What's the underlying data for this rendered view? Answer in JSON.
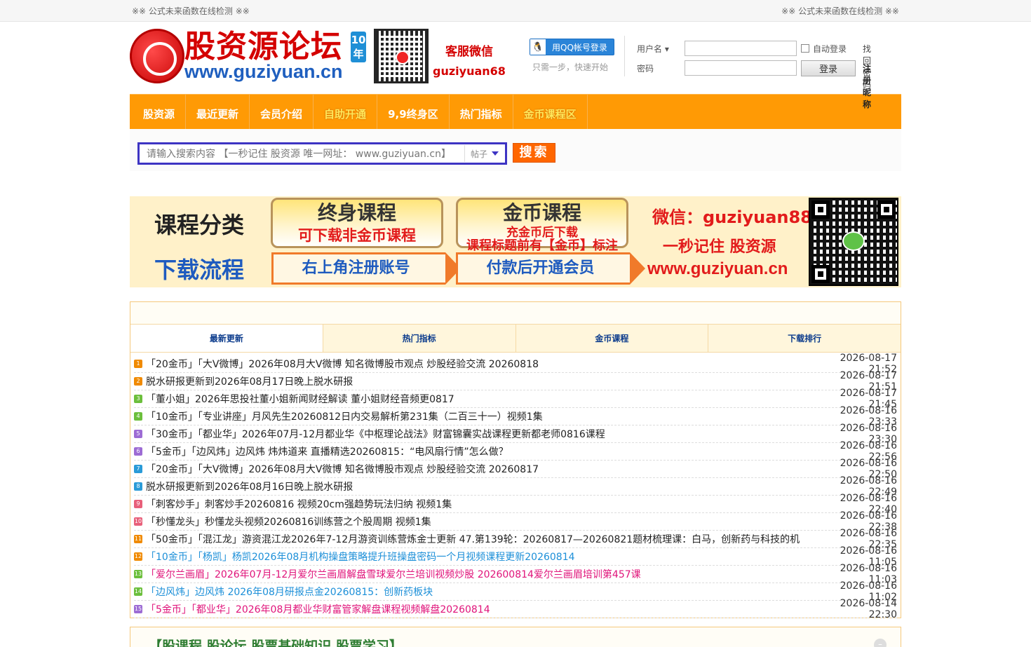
{
  "topbar": {
    "left": "※※ 公式未来函数在线检测 ※※",
    "right": "※※ 公式未来函数在线检测 ※※"
  },
  "logo": {
    "title": "股资源论坛",
    "url": "www.guziyuan.cn",
    "years": "10年"
  },
  "service": {
    "title": "客服微信",
    "wechat": "guziyuan68"
  },
  "qq": {
    "button": "用QQ帐号登录",
    "tip": "只需一步，快速开始"
  },
  "login": {
    "username_label": "用户名",
    "password_label": "密码",
    "auto_login": "自动登录",
    "login_button": "登录",
    "find_password": "找回密码",
    "register": "注册昵称"
  },
  "nav": [
    "股资源",
    "最近更新",
    "会员介绍",
    "自助开通",
    "9,9终身区",
    "热门指标",
    "金币课程区"
  ],
  "search": {
    "placeholder": "请输入搜索内容 【一秒记住 股资源 唯一网址： www.guziyuan.cn】",
    "type": "帖子",
    "button": "搜索"
  },
  "banner": {
    "left_top": "课程分类",
    "left_bottom": "下载流程",
    "pill1_title": "终身课程",
    "pill1_sub": "可下载非金币课程",
    "pill2_title": "金币课程",
    "pill2_sub": "课程标题前有【金币】标注",
    "pill2_overlay": "充金币后下载",
    "step1": "右上角注册账号",
    "step2": "付款后开通会员",
    "wechat": "微信：guziyuan88",
    "slogan": "一秒记住 股资源",
    "url": "www.guziyuan.cn"
  },
  "tabs": [
    "最新更新",
    "热门指标",
    "金币课程",
    "下载排行"
  ],
  "list": [
    {
      "n": "1",
      "c": "#f08a00",
      "t": "「20金币」「大V微博」2026年08月大V微博 知名微博股市观点 炒股经验交流 20260818",
      "time": "2026-08-17 21:52",
      "color": "#222"
    },
    {
      "n": "2",
      "c": "#f08a00",
      "t": "脱水研报更新到2026年08月17日晚上脱水研报",
      "time": "2026-08-17 21:51",
      "color": "#222"
    },
    {
      "n": "3",
      "c": "#6cbf3c",
      "t": "「董小姐」2026年思投社董小姐新闻财经解读 董小姐财经音频更0817",
      "time": "2026-08-17 21:45",
      "color": "#222"
    },
    {
      "n": "4",
      "c": "#6cbf3c",
      "t": "「10金币」「专业讲座」月风先生20260812日内交易解析第231集（二百三十一）视频1集",
      "time": "2026-08-16 23:33",
      "color": "#222"
    },
    {
      "n": "5",
      "c": "#9d6cd4",
      "t": "「30金币」「都业华」2026年07月-12月都业华《中枢理论战法》财富锦囊实战课程更新都老师0816课程",
      "time": "2026-08-16 23:30",
      "color": "#222"
    },
    {
      "n": "6",
      "c": "#9d6cd4",
      "t": "「5金币」「边风炜」边风炜 炜炜道来 直播精选20260815：“电风扇行情”怎么做？",
      "time": "2026-08-16 22:56",
      "color": "#222"
    },
    {
      "n": "7",
      "c": "#2a9bd8",
      "t": "「20金币」「大V微博」2026年08月大V微博 知名微博股市观点 炒股经验交流 20260817",
      "time": "2026-08-16 22:50",
      "color": "#222"
    },
    {
      "n": "8",
      "c": "#2a9bd8",
      "t": "脱水研报更新到2026年08月16日晚上脱水研报",
      "time": "2026-08-16 22:49",
      "color": "#222"
    },
    {
      "n": "9",
      "c": "#e8607a",
      "t": "「刺客炒手」刺客炒手20260816 视频20cm强趋势玩法归纳 视频1集",
      "time": "2026-08-16 22:40",
      "color": "#222"
    },
    {
      "n": "10",
      "c": "#e8607a",
      "t": "「秒懂龙头」秒懂龙头视频20260816训练营之个股周期 视频1集",
      "time": "2026-08-16 22:38",
      "color": "#222"
    },
    {
      "n": "11",
      "c": "#f08a00",
      "t": "「50金币」「混江龙」游资混江龙2026年7-12月游资训练营炼金士更新 47.第139轮：20260817—20260821题材梳理课：白马，创新药与科技的机",
      "time": "2026-08-16 22:35",
      "color": "#222"
    },
    {
      "n": "12",
      "c": "#f08a00",
      "t": "「10金币」「杨凯」杨凯2026年08月机构操盘策略提升班操盘密码一个月视频课程更新20260814",
      "time": "2026-08-16 11:05",
      "color": "#1c8fd8"
    },
    {
      "n": "13",
      "c": "#6cbf3c",
      "t": "「爱尔兰画眉」2026年07月-12月爱尔兰画眉解盘雪球爱尔兰培训视频炒股 202600814爱尔兰画眉培训第457课",
      "time": "2026-08-16 11:03",
      "color": "#e0137a"
    },
    {
      "n": "14",
      "c": "#6cbf3c",
      "t": "「边风炜」边风炜 2026年08月研报点金20260815：创新药板块",
      "time": "2026-08-16 11:02",
      "color": "#1c8fd8"
    },
    {
      "n": "15",
      "c": "#9d6cd4",
      "t": "「5金币」「都业华」2026年08月都业华财富管家解盘课程视频解盘20260814",
      "time": "2026-08-14 22:30",
      "color": "#e0137a"
    }
  ],
  "bottom": {
    "title": "【股课程 股论坛 股票基础知识 股票学习】"
  }
}
